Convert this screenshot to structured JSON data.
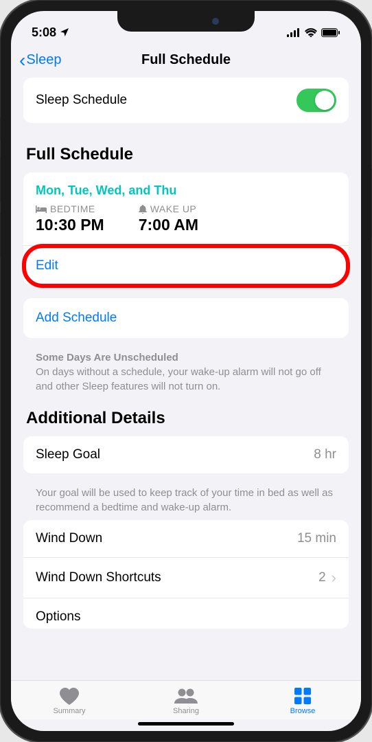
{
  "status_bar": {
    "time": "5:08",
    "location_arrow": "➤"
  },
  "nav": {
    "back_label": "Sleep",
    "title": "Full Schedule"
  },
  "sleep_schedule_toggle": {
    "label": "Sleep Schedule",
    "enabled": true
  },
  "full_schedule": {
    "header": "Full Schedule",
    "days": "Mon, Tue, Wed, and Thu",
    "bedtime_label": "BEDTIME",
    "bedtime_value": "10:30 PM",
    "wakeup_label": "WAKE UP",
    "wakeup_value": "7:00 AM",
    "edit_label": "Edit",
    "add_label": "Add Schedule",
    "footer_heading": "Some Days Are Unscheduled",
    "footer_body": "On days without a schedule, your wake-up alarm will not go off and other Sleep features will not turn on."
  },
  "additional_details": {
    "header": "Additional Details",
    "sleep_goal": {
      "label": "Sleep Goal",
      "value": "8 hr"
    },
    "sleep_goal_footer": "Your goal will be used to keep track of your time in bed as well as recommend a bedtime and wake-up alarm.",
    "wind_down": {
      "label": "Wind Down",
      "value": "15 min"
    },
    "wind_down_shortcuts": {
      "label": "Wind Down Shortcuts",
      "value": "2"
    },
    "options": {
      "label": "Options"
    }
  },
  "tabs": {
    "summary": "Summary",
    "sharing": "Sharing",
    "browse": "Browse"
  }
}
